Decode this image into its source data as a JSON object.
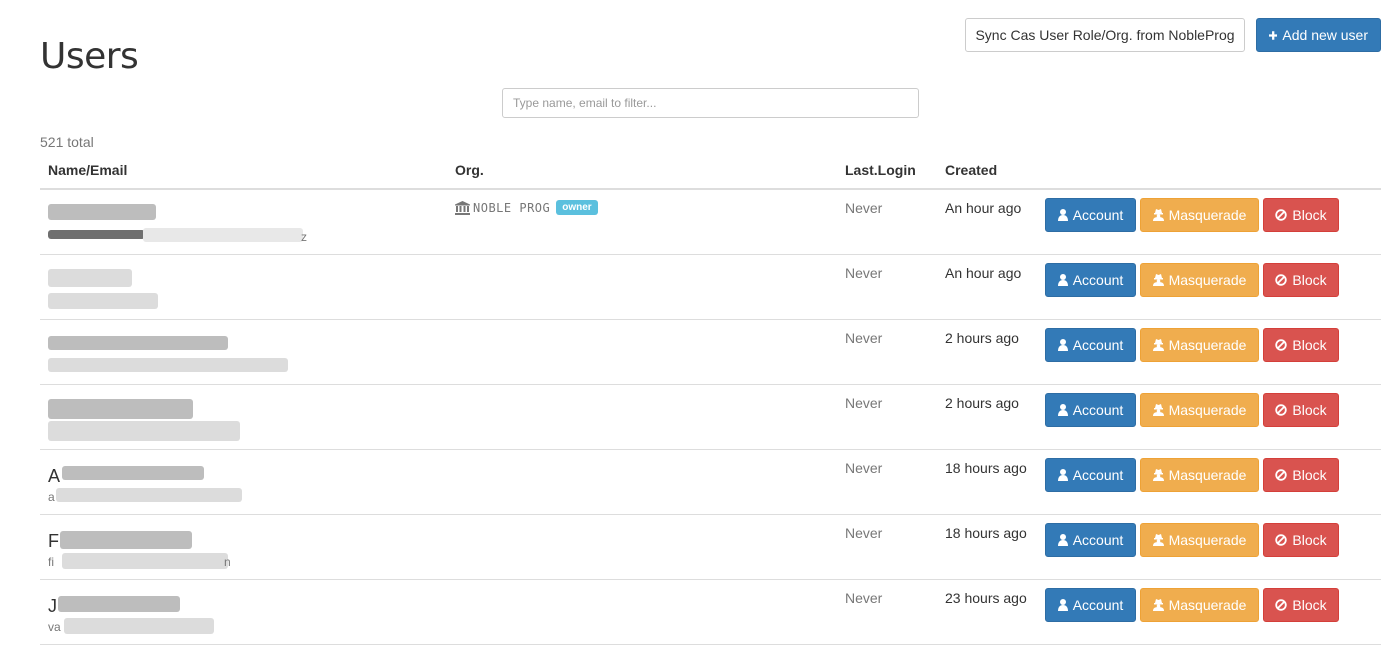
{
  "header": {
    "title": "Users",
    "sync_label": "Sync Cas User Role/Org. from NobleProg",
    "add_label": "Add new user"
  },
  "filter": {
    "placeholder": "Type name, email to filter..."
  },
  "summary": {
    "total_text": "521 total"
  },
  "table": {
    "columns": [
      "Name/Email",
      "Org.",
      "Last.Login",
      "Created"
    ],
    "rows": [
      {
        "name_initial": "",
        "email_suffix": "z",
        "org": "NOBLE PROG",
        "org_badge": "owner",
        "last_login": "Never",
        "created": "An hour ago"
      },
      {
        "name_initial": "",
        "email_suffix": "",
        "org": "",
        "org_badge": "",
        "last_login": "Never",
        "created": "An hour ago"
      },
      {
        "name_initial": "",
        "email_suffix": "",
        "org": "",
        "org_badge": "",
        "last_login": "Never",
        "created": "2 hours ago"
      },
      {
        "name_initial": "",
        "email_suffix": "",
        "org": "",
        "org_badge": "",
        "last_login": "Never",
        "created": "2 hours ago"
      },
      {
        "name_initial": "A",
        "email_prefix": "a",
        "email_suffix": "",
        "org": "",
        "org_badge": "",
        "last_login": "Never",
        "created": "18 hours ago"
      },
      {
        "name_initial": "F",
        "email_prefix": "fi",
        "email_suffix": "n",
        "org": "",
        "org_badge": "",
        "last_login": "Never",
        "created": "18 hours ago"
      },
      {
        "name_initial": "J",
        "email_prefix": "va",
        "email_suffix": "",
        "org": "",
        "org_badge": "",
        "last_login": "Never",
        "created": "23 hours ago"
      }
    ],
    "actions": {
      "account_label": "Account",
      "masquerade_label": "Masquerade",
      "block_label": "Block"
    }
  },
  "colors": {
    "primary": "#337ab7",
    "warning": "#f0ad4e",
    "danger": "#d9534f",
    "info": "#5bc0de"
  },
  "icons": [
    "plus-icon",
    "bank-icon",
    "user-icon",
    "user-secret-icon",
    "ban-icon"
  ]
}
